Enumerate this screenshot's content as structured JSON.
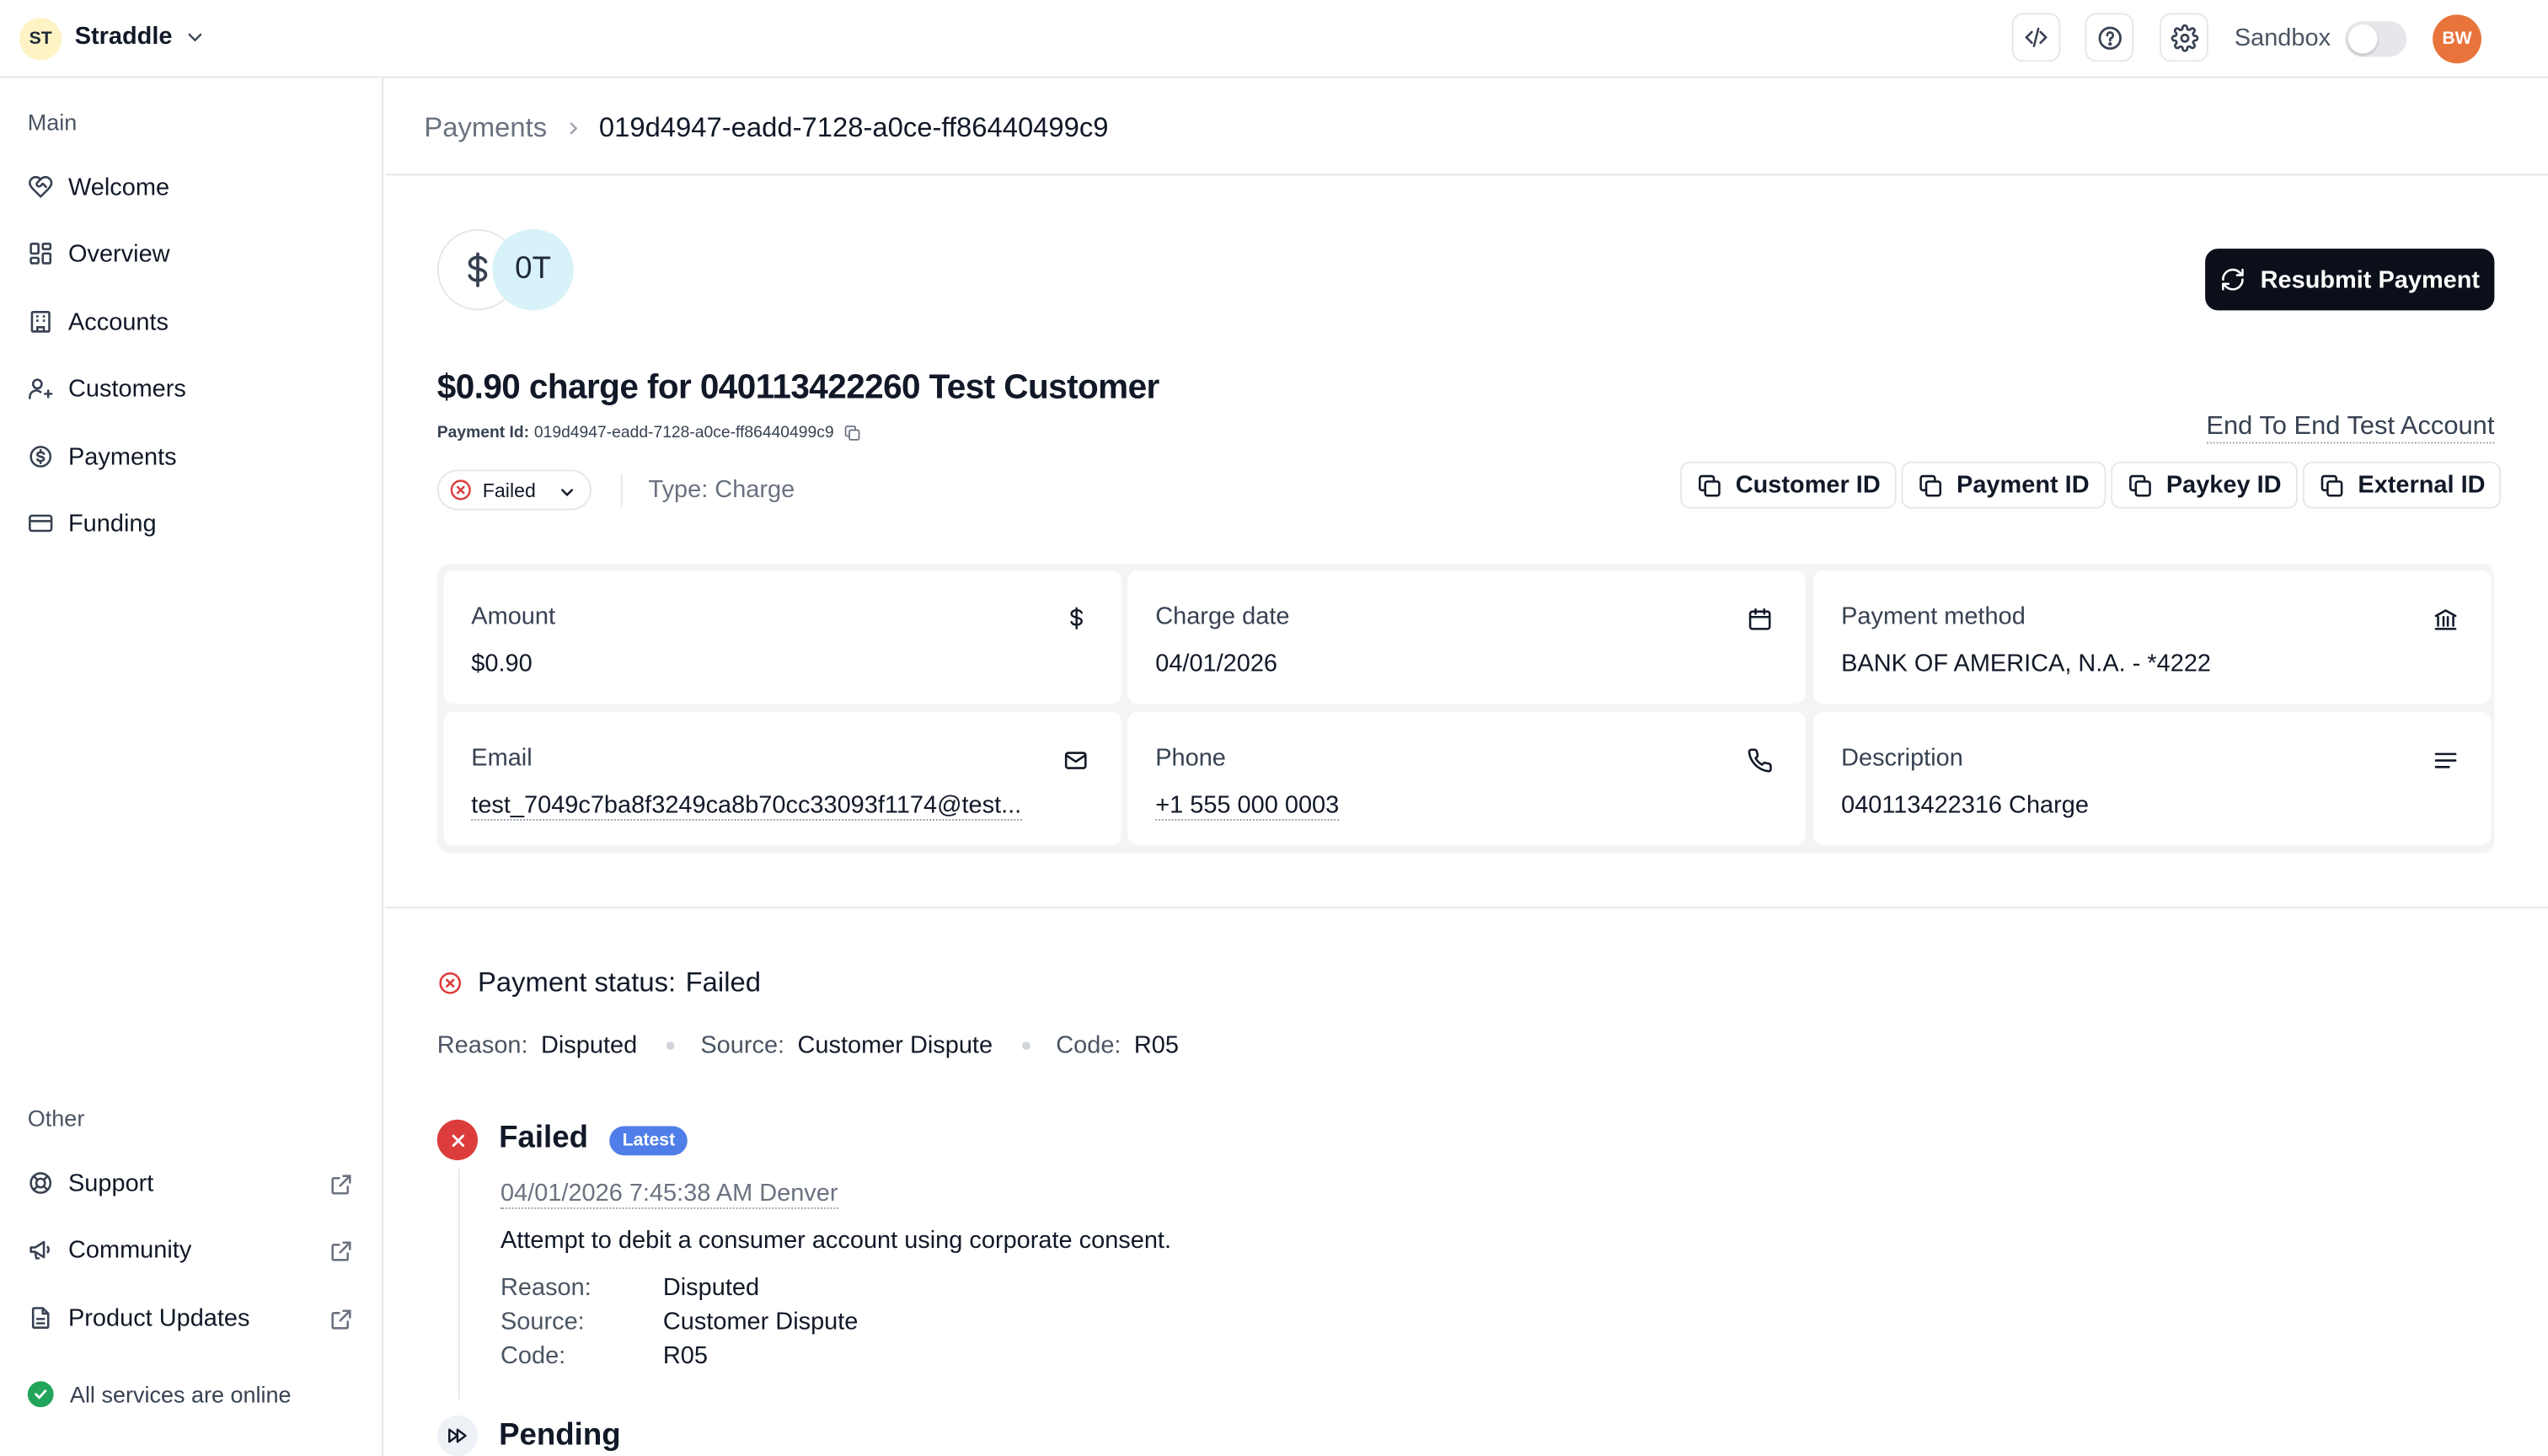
{
  "workspace": {
    "initials": "ST",
    "name": "Straddle"
  },
  "topbar": {
    "icons": [
      "code-icon",
      "help-icon",
      "settings-icon"
    ],
    "sandbox_label": "Sandbox",
    "sandbox_enabled": false,
    "user_initials": "BW"
  },
  "sidebar": {
    "main_label": "Main",
    "main_items": [
      {
        "label": "Welcome",
        "icon": "heart-handshake-icon"
      },
      {
        "label": "Overview",
        "icon": "dashboard-icon"
      },
      {
        "label": "Accounts",
        "icon": "building-icon"
      },
      {
        "label": "Customers",
        "icon": "user-plus-icon"
      },
      {
        "label": "Payments",
        "icon": "dollar-circle-icon"
      },
      {
        "label": "Funding",
        "icon": "card-icon"
      }
    ],
    "other_label": "Other",
    "other_items": [
      {
        "label": "Support",
        "icon": "lifebuoy-icon"
      },
      {
        "label": "Community",
        "icon": "megaphone-icon"
      },
      {
        "label": "Product Updates",
        "icon": "document-icon"
      }
    ],
    "status_text": "All services are online"
  },
  "breadcrumb": {
    "parent": "Payments",
    "current": "019d4947-eadd-7128-a0ce-ff86440499c9"
  },
  "payment": {
    "initials": "0T",
    "title": "$0.90 charge for 040113422260 Test Customer",
    "id_label": "Payment Id:",
    "id_value": "019d4947-eadd-7128-a0ce-ff86440499c9",
    "account_link": "End To End Test Account",
    "status": "Failed",
    "type_text": "Type: Charge",
    "resubmit_label": "Resubmit Payment",
    "id_buttons": [
      "Customer ID",
      "Payment ID",
      "Paykey ID",
      "External ID"
    ]
  },
  "details": {
    "amount_label": "Amount",
    "amount_value": "$0.90",
    "charge_date_label": "Charge date",
    "charge_date_value": "04/01/2026",
    "method_label": "Payment method",
    "method_value": "BANK OF AMERICA, N.A. - *4222",
    "email_label": "Email",
    "email_value": "test_7049c7ba8f3249ca8b70cc33093f1174@test...",
    "phone_label": "Phone",
    "phone_value": "+1 555 000 0003",
    "description_label": "Description",
    "description_value": "040113422316 Charge"
  },
  "payment_status": {
    "label": "Payment status:",
    "value": "Failed",
    "reason_key": "Reason:",
    "reason": "Disputed",
    "source_key": "Source:",
    "source": "Customer Dispute",
    "code_key": "Code:",
    "code": "R05"
  },
  "timeline": [
    {
      "title": "Failed",
      "badge": "Latest",
      "timestamp": "04/01/2026 7:45:38 AM Denver",
      "description": "Attempt to debit a consumer account using corporate consent.",
      "reason_key": "Reason:",
      "reason": "Disputed",
      "source_key": "Source:",
      "source": "Customer Dispute",
      "code_key": "Code:",
      "code": "R05"
    },
    {
      "title": "Pending"
    }
  ],
  "colors": {
    "failed": "#dc3c3c",
    "badge": "#4f7ee8",
    "online": "#22a55b",
    "primary_button": "#0b0f19",
    "avatar": "#e8743b"
  }
}
